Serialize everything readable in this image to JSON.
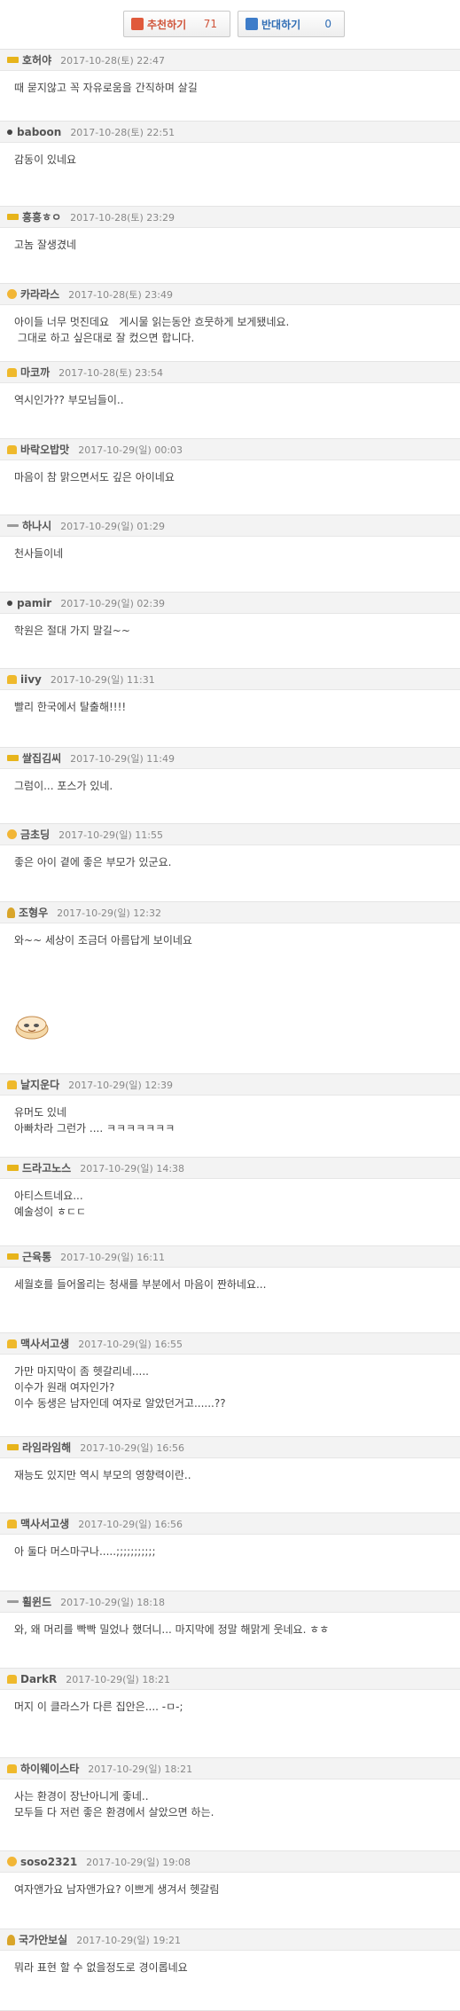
{
  "vote": {
    "up_label": "추천하기",
    "up_count": "71",
    "down_label": "반대하기",
    "down_count": "0"
  },
  "comments": [
    {
      "nick": "호허야",
      "date": "2017-10-28(토) 22:47",
      "lines": [
        "때 묻지않고 꼭 자유로움을 간직하며 살길"
      ],
      "badge": "bar"
    },
    {
      "nick": "baboon",
      "date": "2017-10-28(토) 22:51",
      "lines": [
        "감동이 있네요"
      ],
      "badge": "dot"
    },
    {
      "nick": "흥흥ㅎㅇ",
      "date": "2017-10-28(토) 23:29",
      "lines": [
        "고놈 잘생겼네"
      ],
      "badge": "bar"
    },
    {
      "nick": "카라라스",
      "date": "2017-10-28(토) 23:49",
      "lines": [
        "아이들 너무 멋진데요   게시물 읽는동안 흐뭇하게 보게됐네요.",
        " 그대로 하고 싶은대로 잘 컸으면 합니다."
      ],
      "badge": "sun"
    },
    {
      "nick": "마코까",
      "date": "2017-10-28(토) 23:54",
      "lines": [
        "역시인가?? 부모님들이.."
      ],
      "badge": "crown"
    },
    {
      "nick": "바락오밥맛",
      "date": "2017-10-29(일) 00:03",
      "lines": [
        "마음이 참 맑으면서도 깊은 아이네요"
      ],
      "badge": "crown"
    },
    {
      "nick": "하나시",
      "date": "2017-10-29(일) 01:29",
      "lines": [
        "천사들이네"
      ],
      "badge": "line"
    },
    {
      "nick": "pamir",
      "date": "2017-10-29(일) 02:39",
      "lines": [
        "학원은 절대 가지 말길~~"
      ],
      "badge": "dot"
    },
    {
      "nick": "iivy",
      "date": "2017-10-29(일) 11:31",
      "lines": [
        "빨리 한국에서 탈출해!!!!"
      ],
      "badge": "crown"
    },
    {
      "nick": "쌀집김씨",
      "date": "2017-10-29(일) 11:49",
      "lines": [
        "그럼이... 포스가 있네."
      ],
      "badge": "bar"
    },
    {
      "nick": "금초딩",
      "date": "2017-10-29(일) 11:55",
      "lines": [
        "좋은 아이 곁에 좋은 부모가 있군요."
      ],
      "badge": "sun"
    },
    {
      "nick": "조형우",
      "date": "2017-10-29(일) 12:32",
      "lines": [
        "와~~ 세상이 조금더 아름답게 보이네요"
      ],
      "badge": "gold"
    },
    {
      "nick": "날지운다",
      "date": "2017-10-29(일) 12:39",
      "lines": [
        "유머도 있네",
        "아빠차라 그런가 .... ㅋㅋㅋㅋㅋㅋㅋ"
      ],
      "badge": "crown"
    },
    {
      "nick": "드라고노스",
      "date": "2017-10-29(일) 14:38",
      "lines": [
        "아티스트네요...",
        "예술성이 ㅎㄷㄷ"
      ],
      "badge": "bar"
    },
    {
      "nick": "근육통",
      "date": "2017-10-29(일) 16:11",
      "lines": [
        "세월호를 들어올리는 청새를 부분에서 마음이 짠하네요..."
      ],
      "badge": "bar"
    },
    {
      "nick": "맥사서고생",
      "date": "2017-10-29(일) 16:55",
      "lines": [
        "가만 마지막이 좀 헷갈리네.....",
        "이수가 원래 여자인가?",
        "이수 동생은 남자인데 여자로 알았던거고......??"
      ],
      "badge": "crown"
    },
    {
      "nick": "라임라임해",
      "date": "2017-10-29(일) 16:56",
      "lines": [
        "재능도 있지만 역시 부모의 영향력이란.."
      ],
      "badge": "bar"
    },
    {
      "nick": "맥사서고생",
      "date": "2017-10-29(일) 16:56",
      "lines": [
        "아 둘다 머스마구나.....;;;;;;;;;;;"
      ],
      "badge": "crown"
    },
    {
      "nick": "휠윈드",
      "date": "2017-10-29(일) 18:18",
      "lines": [
        "와, 왜 머리를 빡빡 밀었나 했더니... 마지막에 정말 해맑게 웃네요. ㅎㅎ"
      ],
      "badge": "line"
    },
    {
      "nick": "DarkR",
      "date": "2017-10-29(일) 18:21",
      "lines": [
        "머지 이 클라스가 다른 집안은.... -ㅁ-;"
      ],
      "badge": "crown"
    },
    {
      "nick": "하이웨이스타",
      "date": "2017-10-29(일) 18:21",
      "lines": [
        "사는 환경이 장난아니게 좋네..",
        "모두들 다 저런 좋은 환경에서 살았으면 하는."
      ],
      "badge": "crown"
    },
    {
      "nick": "soso2321",
      "date": "2017-10-29(일) 19:08",
      "lines": [
        "여자앤가요 남자앤가요? 이쁘게 생겨서 헷갈림"
      ],
      "badge": "sun"
    },
    {
      "nick": "국가안보실",
      "date": "2017-10-29(일) 19:21",
      "lines": [
        "뭐라 표현 할 수 없을정도로 경이롭네요"
      ],
      "badge": "gold"
    }
  ]
}
